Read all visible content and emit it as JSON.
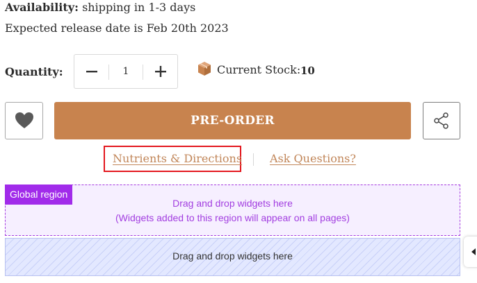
{
  "availability": {
    "label": "Availability:",
    "value": "shipping in 1-3 days"
  },
  "release": {
    "text": "Expected release date is Feb 20th 2023"
  },
  "quantity": {
    "label": "Quantity:",
    "value": "1"
  },
  "stock": {
    "label": "Current Stock:",
    "value": "10",
    "icon": "package-icon"
  },
  "actions": {
    "preorder_label": "PRE-ORDER",
    "wishlist_icon": "heart-icon",
    "share_icon": "share-icon",
    "primary_color": "#c8834e"
  },
  "links": {
    "nutrients": "Nutrients & Directions",
    "ask": "Ask Questions?",
    "link_color": "#c18659"
  },
  "global_region": {
    "tag": "Global region",
    "line1": "Drag and drop widgets here",
    "line2": "(Widgets added to this region will appear on all pages)",
    "accent": "#a12bea"
  },
  "blue_region": {
    "text": "Drag and drop widgets here"
  }
}
